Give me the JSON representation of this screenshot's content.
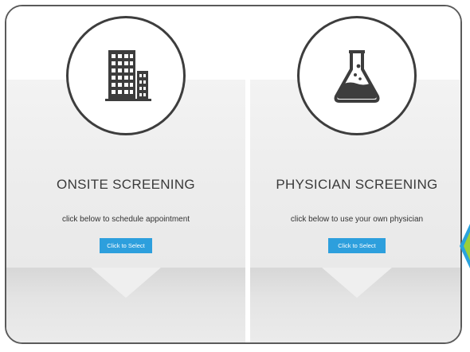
{
  "cards": [
    {
      "title": "ONSITE SCREENING",
      "subtitle": "click below to schedule appointment",
      "button_label": "Click to Select",
      "icon": "office-building-icon"
    },
    {
      "title": "PHYSICIAN SCREENING",
      "subtitle": "click below to use your own physician",
      "button_label": "Click to Select",
      "icon": "lab-flask-icon"
    }
  ],
  "colors": {
    "button": "#2d9fdd",
    "icon_stroke": "#3d3d3d",
    "accent_blue": "#2aa3dd",
    "accent_green": "#9bcf3a"
  }
}
